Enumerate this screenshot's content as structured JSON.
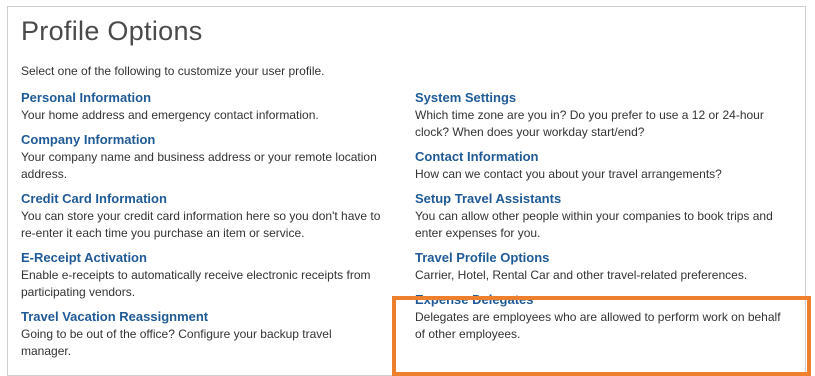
{
  "page": {
    "title": "Profile Options",
    "intro": "Select one of the following to customize your user profile."
  },
  "left_options": [
    {
      "label": "Personal Information",
      "desc": "Your home address and emergency contact information."
    },
    {
      "label": "Company Information",
      "desc": "Your company name and business address or your remote location address."
    },
    {
      "label": "Credit Card Information",
      "desc": "You can store your credit card information here so you don't have to re-enter it each time you purchase an item or service."
    },
    {
      "label": "E-Receipt Activation",
      "desc": "Enable e-receipts to automatically receive electronic receipts from participating vendors."
    },
    {
      "label": "Travel Vacation Reassignment",
      "desc": "Going to be out of the office? Configure your backup travel manager."
    }
  ],
  "right_options": [
    {
      "label": "System Settings",
      "desc": "Which time zone are you in? Do you prefer to use a 12 or 24-hour clock? When does your workday start/end?"
    },
    {
      "label": "Contact Information",
      "desc": "How can we contact you about your travel arrangements?"
    },
    {
      "label": "Setup Travel Assistants",
      "desc": "You can allow other people within your companies to book trips and enter expenses for you."
    },
    {
      "label": "Travel Profile Options",
      "desc": "Carrier, Hotel, Rental Car and other travel-related preferences."
    },
    {
      "label": "Expense Delegates",
      "desc": "Delegates are employees who are allowed to perform work on behalf of other employees."
    }
  ],
  "colors": {
    "link": "#1f5a96",
    "highlight": "#ee7f2d"
  }
}
